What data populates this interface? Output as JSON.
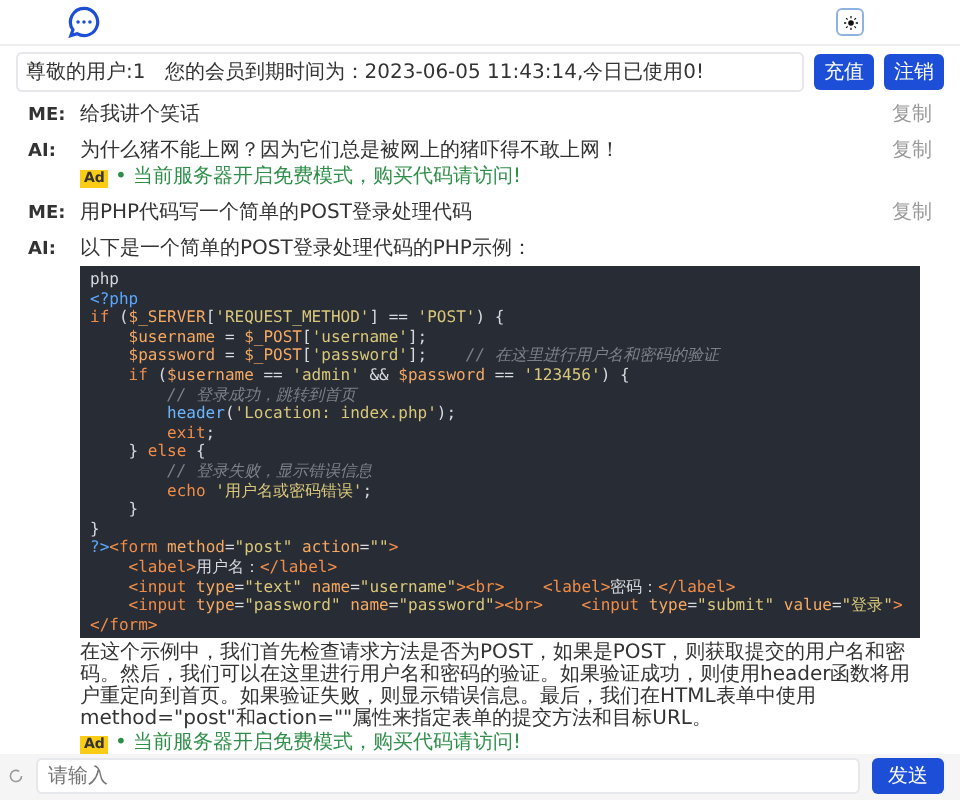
{
  "header": {
    "theme_button": {
      "selected": false
    }
  },
  "info": {
    "text": "尊敬的用户:1   您的会员到期时间为：2023-06-05 11:43:14,今日已使用0!",
    "buttons": [
      "充值",
      "注销"
    ]
  },
  "messages": [
    {
      "role": "ME:",
      "text": "给我讲个笑话",
      "copy": "复制"
    },
    {
      "role": "AI:",
      "text": "为什么猪不能上网？因为它们总是被网上的猪吓得不敢上网！",
      "copy": "复制",
      "ad": {
        "badge": "Ad",
        "text": "• 当前服务器开启免费模式，购买代码请访问!"
      }
    },
    {
      "role": "ME:",
      "text": "用PHP代码写一个简单的POST登录处理代码",
      "copy": "复制"
    },
    {
      "role": "AI:",
      "text": "以下是一个简单的POST登录处理代码的PHP示例：",
      "code": [
        [
          {
            "kind": "plain",
            "text": "php"
          }
        ],
        [
          {
            "kind": "tag",
            "text": "<?php"
          }
        ],
        [
          {
            "kind": "kw",
            "text": "if"
          },
          {
            "kind": "plain",
            "text": " ("
          },
          {
            "kind": "var",
            "text": "$_SERVER"
          },
          {
            "kind": "plain",
            "text": "["
          },
          {
            "kind": "str",
            "text": "'REQUEST_METHOD'"
          },
          {
            "kind": "plain",
            "text": "] == "
          },
          {
            "kind": "str",
            "text": "'POST'"
          },
          {
            "kind": "plain",
            "text": ") {"
          }
        ],
        [
          {
            "kind": "var",
            "text": "    $username"
          },
          {
            "kind": "plain",
            "text": " = "
          },
          {
            "kind": "var",
            "text": "$_POST"
          },
          {
            "kind": "plain",
            "text": "["
          },
          {
            "kind": "str",
            "text": "'username'"
          },
          {
            "kind": "plain",
            "text": "];"
          }
        ],
        [
          {
            "kind": "var",
            "text": "    $password"
          },
          {
            "kind": "plain",
            "text": " = "
          },
          {
            "kind": "var",
            "text": "$_POST"
          },
          {
            "kind": "plain",
            "text": "["
          },
          {
            "kind": "str",
            "text": "'password'"
          },
          {
            "kind": "plain",
            "text": "];"
          },
          {
            "kind": "comment",
            "text": "    // 在这里进行用户名和密码的验证"
          }
        ],
        [
          {
            "kind": "kw",
            "text": "    if"
          },
          {
            "kind": "plain",
            "text": " ("
          },
          {
            "kind": "var",
            "text": "$username"
          },
          {
            "kind": "plain",
            "text": " == "
          },
          {
            "kind": "str",
            "text": "'admin'"
          },
          {
            "kind": "plain",
            "text": " && "
          },
          {
            "kind": "var",
            "text": "$password"
          },
          {
            "kind": "plain",
            "text": " == "
          },
          {
            "kind": "str",
            "text": "'123456'"
          },
          {
            "kind": "plain",
            "text": ") {"
          }
        ],
        [
          {
            "kind": "comment",
            "text": "        // 登录成功，跳转到首页"
          }
        ],
        [
          {
            "kind": "func",
            "text": "        header"
          },
          {
            "kind": "plain",
            "text": "("
          },
          {
            "kind": "str",
            "text": "'Location: index.php'"
          },
          {
            "kind": "plain",
            "text": ");"
          }
        ],
        [
          {
            "kind": "kw",
            "text": "        exit"
          },
          {
            "kind": "plain",
            "text": ";"
          }
        ],
        [
          {
            "kind": "plain",
            "text": "    } "
          },
          {
            "kind": "kw",
            "text": "else"
          },
          {
            "kind": "plain",
            "text": " {"
          }
        ],
        [
          {
            "kind": "comment",
            "text": "        // 登录失败，显示错误信息"
          }
        ],
        [
          {
            "kind": "kw",
            "text": "        echo"
          },
          {
            "kind": "str",
            "text": " '用户名或密码错误'"
          },
          {
            "kind": "plain",
            "text": ";"
          }
        ],
        [
          {
            "kind": "plain",
            "text": "    }"
          }
        ],
        [
          {
            "kind": "plain",
            "text": "}"
          }
        ],
        [
          {
            "kind": "tag",
            "text": "?>"
          },
          {
            "kind": "kw",
            "text": "<form"
          },
          {
            "kind": "var",
            "text": " method"
          },
          {
            "kind": "plain",
            "text": "="
          },
          {
            "kind": "str",
            "text": "\"post\""
          },
          {
            "kind": "var",
            "text": " action"
          },
          {
            "kind": "plain",
            "text": "="
          },
          {
            "kind": "str",
            "text": "\"\""
          },
          {
            "kind": "kw",
            "text": ">"
          }
        ],
        [
          {
            "kind": "kw",
            "text": "    <label>"
          },
          {
            "kind": "plain",
            "text": "用户名："
          },
          {
            "kind": "kw",
            "text": "</label>"
          }
        ],
        [
          {
            "kind": "kw",
            "text": "    <input"
          },
          {
            "kind": "var",
            "text": " type"
          },
          {
            "kind": "plain",
            "text": "="
          },
          {
            "kind": "str",
            "text": "\"text\""
          },
          {
            "kind": "var",
            "text": " name"
          },
          {
            "kind": "plain",
            "text": "="
          },
          {
            "kind": "str",
            "text": "\"username\""
          },
          {
            "kind": "kw",
            "text": "><br>    <label>"
          },
          {
            "kind": "plain",
            "text": "密码："
          },
          {
            "kind": "kw",
            "text": "</label>"
          }
        ],
        [
          {
            "kind": "kw",
            "text": "    <input"
          },
          {
            "kind": "var",
            "text": " type"
          },
          {
            "kind": "plain",
            "text": "="
          },
          {
            "kind": "str",
            "text": "\"password\""
          },
          {
            "kind": "var",
            "text": " name"
          },
          {
            "kind": "plain",
            "text": "="
          },
          {
            "kind": "str",
            "text": "\"password\""
          },
          {
            "kind": "kw",
            "text": "><br>    <input"
          },
          {
            "kind": "var",
            "text": " type"
          },
          {
            "kind": "plain",
            "text": "="
          },
          {
            "kind": "str",
            "text": "\"submit\""
          },
          {
            "kind": "var",
            "text": " value"
          },
          {
            "kind": "plain",
            "text": "="
          },
          {
            "kind": "str",
            "text": "\"登录\""
          },
          {
            "kind": "kw",
            "text": ">"
          }
        ],
        [
          {
            "kind": "kw",
            "text": "</form>"
          }
        ]
      ],
      "after": "在这个示例中，我们首先检查请求方法是否为POST，如果是POST，则获取提交的用户名和密码。然后，我们可以在这里进行用户名和密码的验证。如果验证成功，则使用header函数将用户重定向到首页。如果验证失败，则显示错误信息。最后，我们在HTML表单中使用method=\"post\"和action=\"\"属性来指定表单的提交方法和目标URL。",
      "ad": {
        "badge": "Ad",
        "text": "• 当前服务器开启免费模式，购买代码请访问!"
      }
    }
  ],
  "composer": {
    "placeholder": "请输入",
    "send": "发送"
  }
}
